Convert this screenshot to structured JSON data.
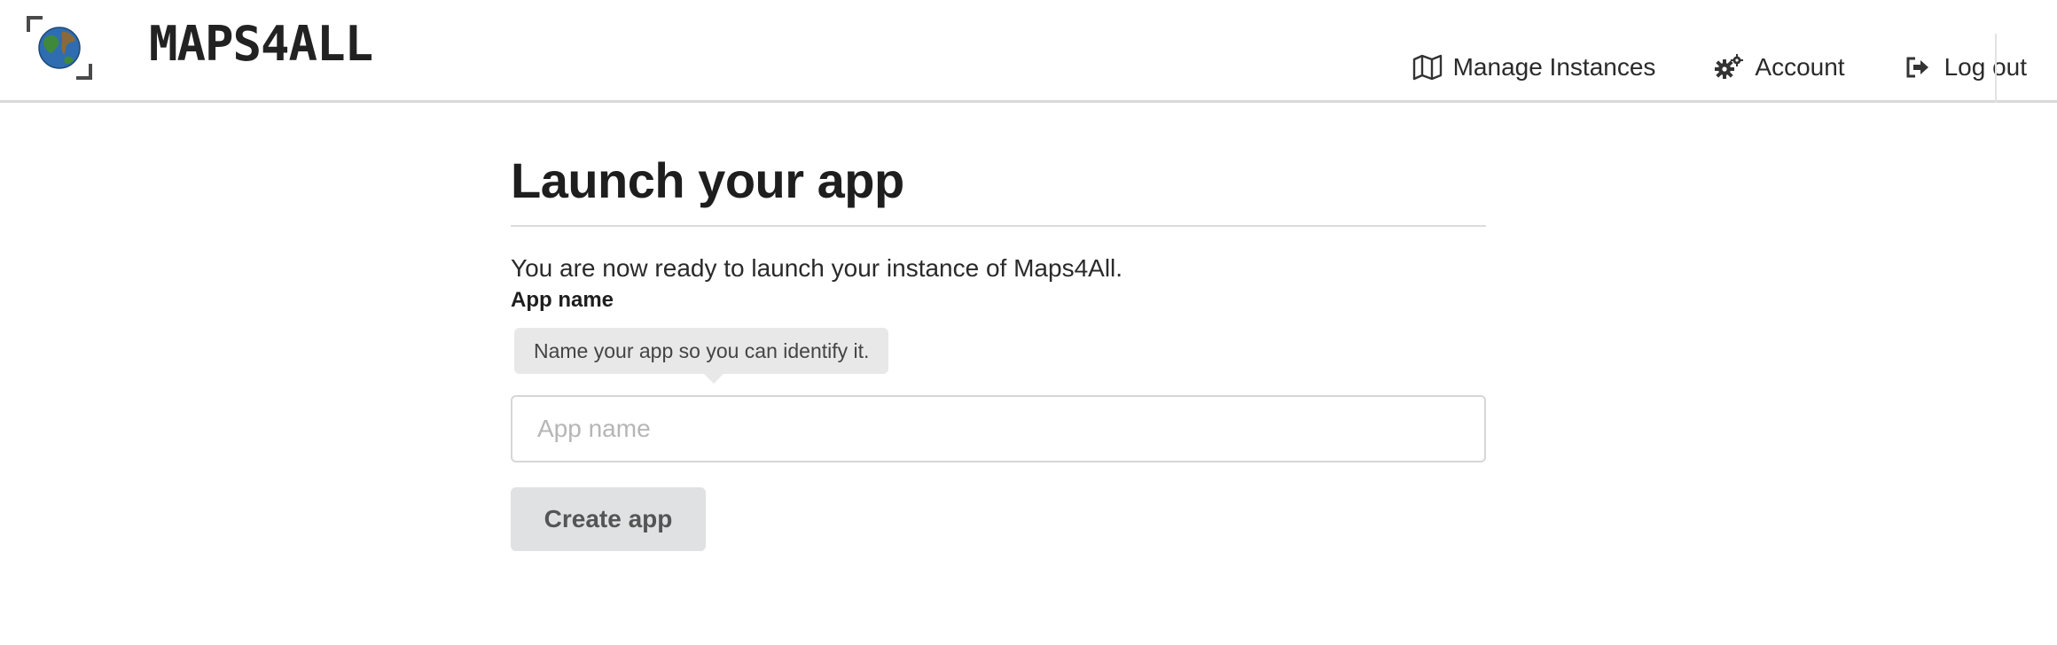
{
  "header": {
    "brand": "MAPS4ALL",
    "logo_icon": "globe-icon",
    "nav": [
      {
        "label": "Manage Instances",
        "icon": "map-icon"
      },
      {
        "label": "Account",
        "icon": "gears-icon"
      },
      {
        "label": "Log out",
        "icon": "sign-out-icon"
      }
    ]
  },
  "main": {
    "title": "Launch your app",
    "intro": "You are now ready to launch your instance of Maps4All.",
    "field_label": "App name",
    "tooltip": "Name your app so you can identify it.",
    "input_placeholder": "App name",
    "input_value": "",
    "submit_label": "Create app"
  },
  "colors": {
    "text": "#222222",
    "button_bg": "#e0e1e2",
    "tooltip_bg": "#e8e8e8",
    "border": "#d6d6d6",
    "globe_ocean": "#2f6db0",
    "globe_land": "#3f8a3a"
  }
}
